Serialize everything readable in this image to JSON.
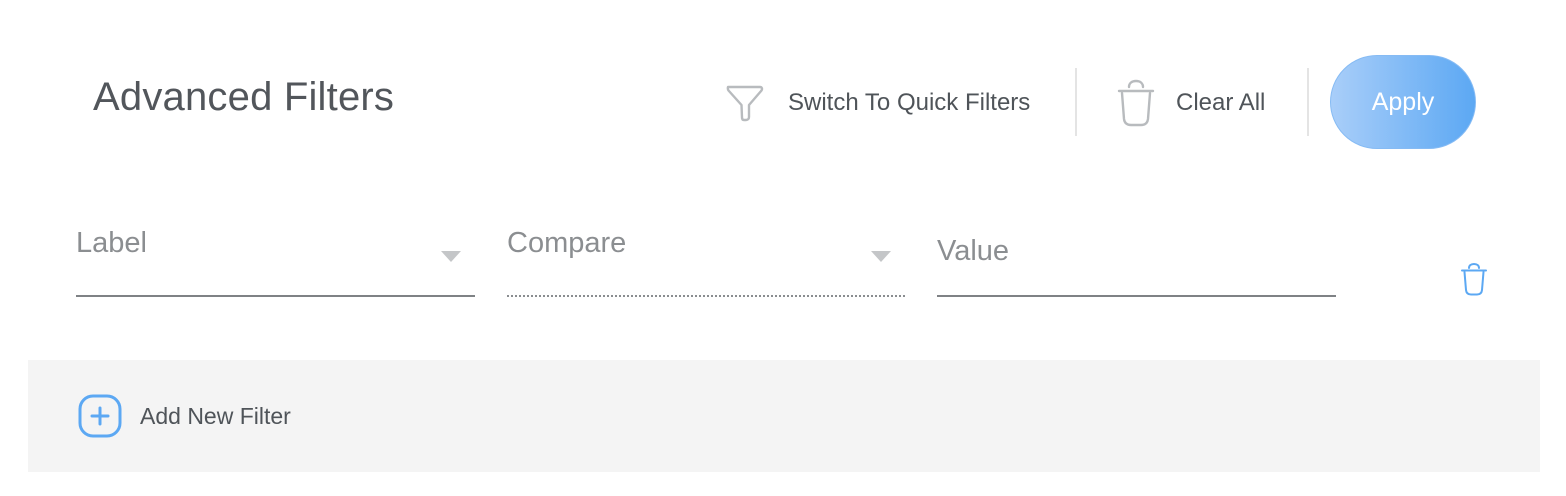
{
  "header": {
    "title": "Advanced Filters",
    "switch_label": "Switch To Quick Filters",
    "switch_icon": "funnel-icon",
    "clear_label": "Clear All",
    "clear_icon": "trash-icon",
    "apply_label": "Apply"
  },
  "filter_row": {
    "label_placeholder": "Label",
    "compare_placeholder": "Compare",
    "value_placeholder": "Value",
    "delete_icon": "trash-icon"
  },
  "footer": {
    "add_label": "Add New Filter",
    "add_icon": "plus-square-icon"
  },
  "colors": {
    "accent": "#5ca8f3",
    "accent_light": "#a9cef9",
    "text": "#52565b",
    "placeholder": "#8b8e91",
    "bar_background": "#f4f4f4"
  }
}
